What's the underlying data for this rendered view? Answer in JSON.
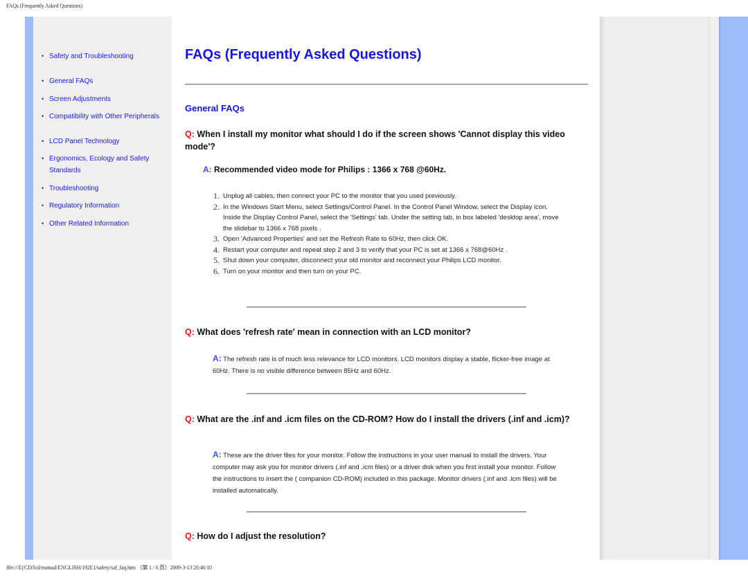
{
  "header": {
    "title": "FAQs (Frequently Asked Questions)"
  },
  "footer": {
    "path": "file:///E|/CD/lcd/manual/ENGLISH/192E1/safety/saf_faq.htm （第 1 / 6 页）2009-3-13 20:46:10"
  },
  "colors": {
    "link": "#1a1adb",
    "title": "#1515e0",
    "q_mark": "#e8121a",
    "a_mark": "#3b4fe8",
    "stripe": "#9fbcf8"
  },
  "sidebar": {
    "items": [
      {
        "label": "Safety and Troubleshooting"
      },
      {
        "label": "General FAQs"
      },
      {
        "label": "Screen Adjustments"
      },
      {
        "label": "Compatibility with Other Peripherals"
      },
      {
        "label": "LCD Panel Technology"
      },
      {
        "label": "Ergonomics, Ecology and Safety Standards"
      },
      {
        "label": "Troubleshooting"
      },
      {
        "label": "Regulatory Information"
      },
      {
        "label": "Other Related Information"
      }
    ],
    "bullet": "•"
  },
  "main": {
    "title": "FAQs (Frequently Asked Questions)",
    "section": "General FAQs",
    "q_label": "Q:",
    "a_label": "A:",
    "faqs": [
      {
        "question": "When I install my monitor what should I do if the screen shows 'Cannot display this video mode'?",
        "answer": "Recommended video mode for Philips : 1366 x 768 @60Hz.",
        "steps": [
          {
            "num": "1.",
            "text": "Unplug all cables, then connect your PC to the monitor that you used previously."
          },
          {
            "num": "2.",
            "text": "In the Windows Start Menu, select Settings/Control Panel. In the Control Panel Window, select the Display icon. Inside the Display Control Panel, select the 'Settings' tab. Under the setting tab, in box labeled 'desktop area', move the slidebar to 1366 x 768 pixels ."
          },
          {
            "num": "3.",
            "text": "Open 'Advanced Properties' and set the Refresh Rate to 60Hz, then click OK."
          },
          {
            "num": "4.",
            "text": "Restart your computer and repeat step 2 and 3 to verify that your PC is set at 1366 x 768@60Hz ."
          },
          {
            "num": "5.",
            "text": "Shut down your computer, disconnect your old monitor and reconnect your Philips LCD monitor."
          },
          {
            "num": "6.",
            "text": "Turn on your monitor and then turn on your PC."
          }
        ]
      },
      {
        "question": "What does 'refresh rate' mean in connection with an LCD monitor?",
        "answer": "The refresh rate is of much less relevance for LCD monitors. LCD monitors display a stable, flicker-free image at 60Hz. There is no visible difference between 85Hz and 60Hz."
      },
      {
        "question": "What are the .inf and .icm files on the CD-ROM? How do I install the drivers (.inf and .icm)?",
        "answer": "These are the driver files for your monitor. Follow the instructions in your user manual to install the drivers. Your computer may ask you for monitor drivers (.inf and .icm files) or a driver disk when you first install your monitor. Follow the instructions to insert the ( companion CD-ROM) included in this package. Monitor drivers (.inf and .icm files) will be installed automatically."
      },
      {
        "question": "How do I adjust the resolution?"
      }
    ]
  }
}
